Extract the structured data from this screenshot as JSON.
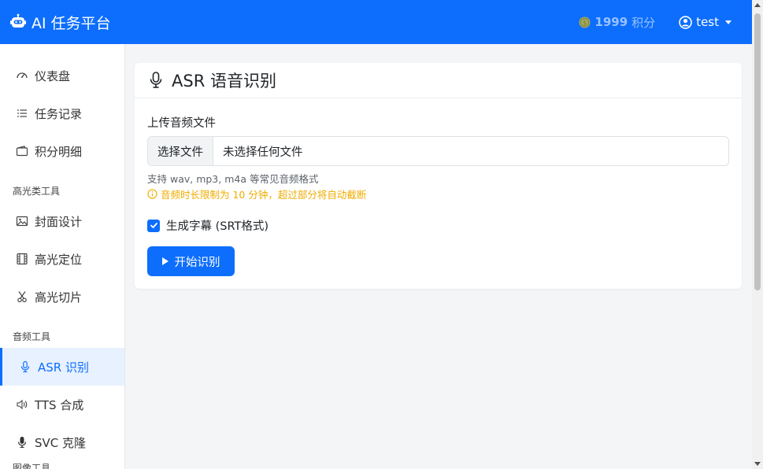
{
  "header": {
    "brand": "AI 任务平台",
    "points_value": "1999",
    "points_unit": "积分",
    "user": "test"
  },
  "sidebar": {
    "items": [
      {
        "label": "仪表盘",
        "icon": "dashboard-icon"
      },
      {
        "label": "任务记录",
        "icon": "list-icon"
      },
      {
        "label": "积分明细",
        "icon": "wallet-icon"
      }
    ],
    "section_highlight": "高光类工具",
    "highlight_items": [
      {
        "label": "封面设计",
        "icon": "image-icon"
      },
      {
        "label": "高光定位",
        "icon": "film-icon"
      },
      {
        "label": "高光切片",
        "icon": "scissors-icon"
      }
    ],
    "section_audio": "音频工具",
    "audio_items": [
      {
        "label": "ASR 识别",
        "icon": "mic-icon",
        "active": true
      },
      {
        "label": "TTS 合成",
        "icon": "volume-icon"
      },
      {
        "label": "SVC 克隆",
        "icon": "mic-fill-icon"
      }
    ],
    "section_image": "图像工具"
  },
  "card": {
    "title": "ASR 语音识别",
    "upload_label": "上传音频文件",
    "file_button": "选择文件",
    "file_status": "未选择任何文件",
    "hint": "支持 wav, mp3, m4a 等常见音频格式",
    "warning": "音频时长限制为 10 分钟，超过部分将自动截断",
    "checkbox_label": "生成字幕 (SRT格式)",
    "checkbox_checked": true,
    "submit": "开始识别"
  },
  "colors": {
    "primary": "#0d6efd",
    "warning": "#f0ad00",
    "active_bg": "#e7f1ff"
  }
}
